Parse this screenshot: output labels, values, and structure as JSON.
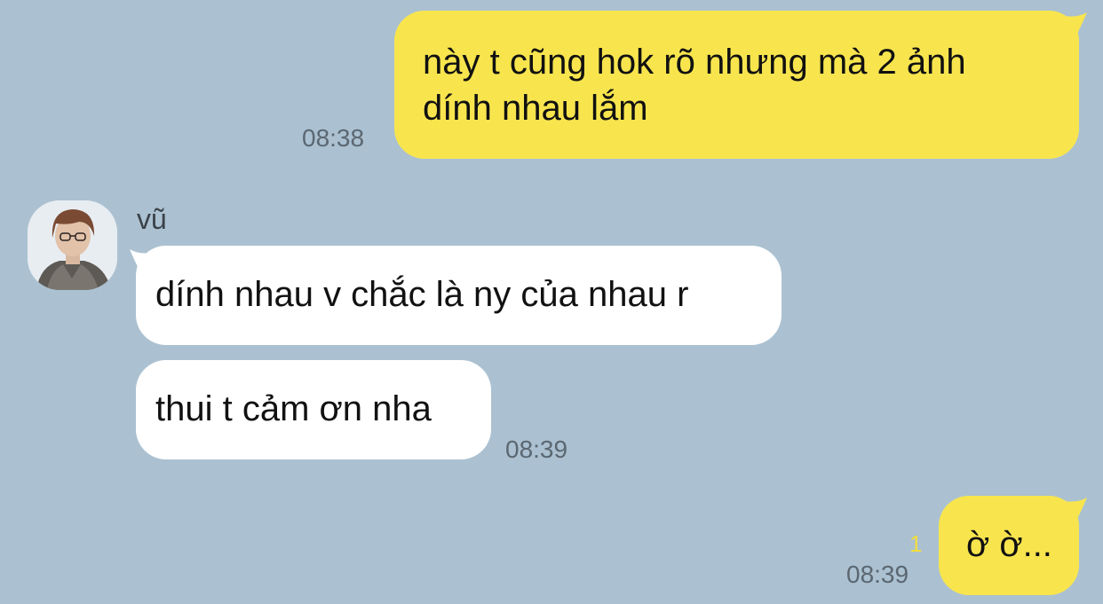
{
  "colors": {
    "background": "#abc1d1",
    "my_bubble": "#f8e54e",
    "their_bubble": "#ffffff",
    "unread_count": "#f3dd3e"
  },
  "conversation": {
    "messages": [
      {
        "side": "mine",
        "lines": [
          "này t cũng hok rõ nhưng mà 2 ảnh",
          "dính nhau lắm"
        ],
        "time": "08:38"
      },
      {
        "side": "theirs",
        "sender": "vũ",
        "lines": [
          "dính nhau v chắc là ny của nhau r"
        ]
      },
      {
        "side": "theirs",
        "lines": [
          "thui t cảm ơn nha"
        ],
        "time": "08:39"
      },
      {
        "side": "mine",
        "lines": [
          "ờ ờ..."
        ],
        "time": "08:39",
        "unread": "1"
      }
    ]
  },
  "avatar": {
    "icon": "profile-photo-avatar"
  }
}
